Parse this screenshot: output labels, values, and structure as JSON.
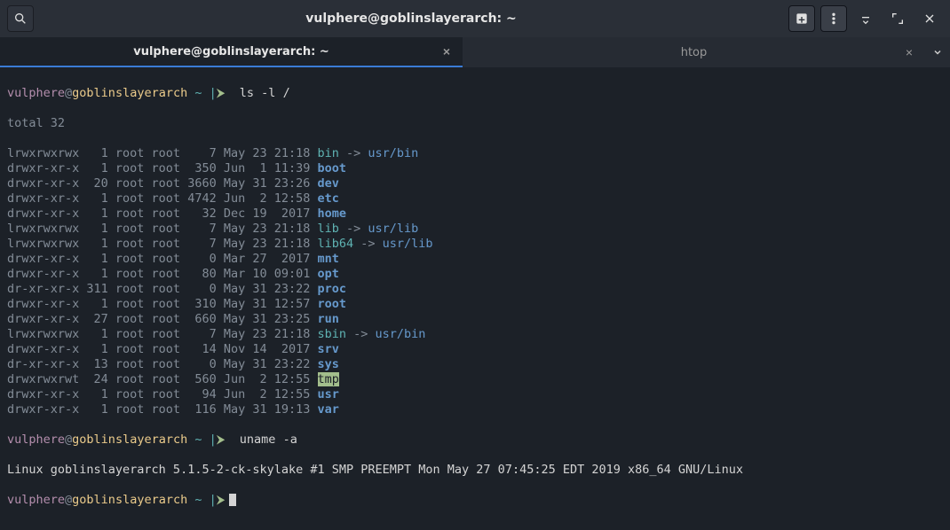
{
  "window_title": "vulphere@goblinslayerarch: ~",
  "tabs": [
    {
      "label": "vulphere@goblinslayerarch: ~",
      "active": true
    },
    {
      "label": "htop",
      "active": false
    }
  ],
  "prompt": {
    "user": "vulphere",
    "at": "@",
    "host": "goblinslayerarch",
    "path": "~",
    "sep1": " |",
    "sep2": "⮞"
  },
  "cmd1": "ls -l /",
  "cmd2": "uname -a",
  "total_line": "total 32",
  "listing": [
    {
      "perm": "lrwxrwxrwx",
      "n": "1",
      "own": "root root",
      "size": "7",
      "date": "May 23 21:18",
      "name": "bin",
      "link": "usr/bin",
      "kind": "sym"
    },
    {
      "perm": "drwxr-xr-x",
      "n": "1",
      "own": "root root",
      "size": "350",
      "date": "Jun  1 11:39",
      "name": "boot",
      "kind": "dir"
    },
    {
      "perm": "drwxr-xr-x",
      "n": "20",
      "own": "root root",
      "size": "3660",
      "date": "May 31 23:26",
      "name": "dev",
      "kind": "dir"
    },
    {
      "perm": "drwxr-xr-x",
      "n": "1",
      "own": "root root",
      "size": "4742",
      "date": "Jun  2 12:58",
      "name": "etc",
      "kind": "dir"
    },
    {
      "perm": "drwxr-xr-x",
      "n": "1",
      "own": "root root",
      "size": "32",
      "date": "Dec 19  2017",
      "name": "home",
      "kind": "dir"
    },
    {
      "perm": "lrwxrwxrwx",
      "n": "1",
      "own": "root root",
      "size": "7",
      "date": "May 23 21:18",
      "name": "lib",
      "link": "usr/lib",
      "kind": "sym"
    },
    {
      "perm": "lrwxrwxrwx",
      "n": "1",
      "own": "root root",
      "size": "7",
      "date": "May 23 21:18",
      "name": "lib64",
      "link": "usr/lib",
      "kind": "sym"
    },
    {
      "perm": "drwxr-xr-x",
      "n": "1",
      "own": "root root",
      "size": "0",
      "date": "Mar 27  2017",
      "name": "mnt",
      "kind": "dir"
    },
    {
      "perm": "drwxr-xr-x",
      "n": "1",
      "own": "root root",
      "size": "80",
      "date": "Mar 10 09:01",
      "name": "opt",
      "kind": "dir"
    },
    {
      "perm": "dr-xr-xr-x",
      "n": "311",
      "own": "root root",
      "size": "0",
      "date": "May 31 23:22",
      "name": "proc",
      "kind": "dir"
    },
    {
      "perm": "drwxr-xr-x",
      "n": "1",
      "own": "root root",
      "size": "310",
      "date": "May 31 12:57",
      "name": "root",
      "kind": "dir"
    },
    {
      "perm": "drwxr-xr-x",
      "n": "27",
      "own": "root root",
      "size": "660",
      "date": "May 31 23:25",
      "name": "run",
      "kind": "dir"
    },
    {
      "perm": "lrwxrwxrwx",
      "n": "1",
      "own": "root root",
      "size": "7",
      "date": "May 23 21:18",
      "name": "sbin",
      "link": "usr/bin",
      "kind": "sym"
    },
    {
      "perm": "drwxr-xr-x",
      "n": "1",
      "own": "root root",
      "size": "14",
      "date": "Nov 14  2017",
      "name": "srv",
      "kind": "dir"
    },
    {
      "perm": "dr-xr-xr-x",
      "n": "13",
      "own": "root root",
      "size": "0",
      "date": "May 31 23:22",
      "name": "sys",
      "kind": "dir"
    },
    {
      "perm": "drwxrwxrwt",
      "n": "24",
      "own": "root root",
      "size": "560",
      "date": "Jun  2 12:55",
      "name": "tmp",
      "kind": "tmp"
    },
    {
      "perm": "drwxr-xr-x",
      "n": "1",
      "own": "root root",
      "size": "94",
      "date": "Jun  2 12:55",
      "name": "usr",
      "kind": "dir"
    },
    {
      "perm": "drwxr-xr-x",
      "n": "1",
      "own": "root root",
      "size": "116",
      "date": "May 31 19:13",
      "name": "var",
      "kind": "dir"
    }
  ],
  "uname_output": "Linux goblinslayerarch 5.1.5-2-ck-skylake #1 SMP PREEMPT Mon May 27 07:45:25 EDT 2019 x86_64 GNU/Linux"
}
